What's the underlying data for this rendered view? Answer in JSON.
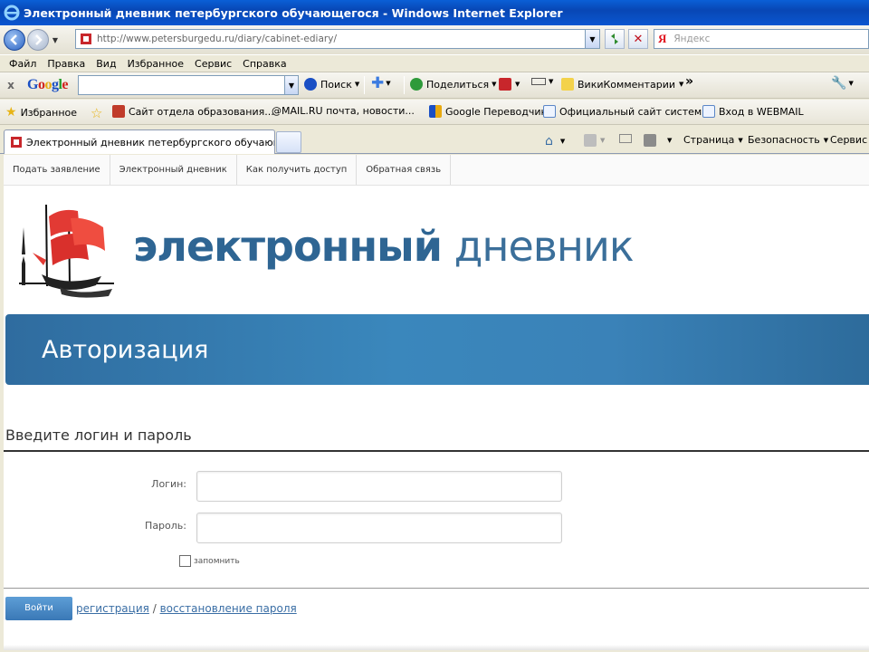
{
  "window": {
    "title": "Электронный дневник петербургского обучающегося - Windows Internet Explorer"
  },
  "address": {
    "url": "http://www.petersburgedu.ru/diary/cabinet-ediary/",
    "search_placeholder": "Яндекс",
    "search_brand": "Я"
  },
  "menu": [
    "Файл",
    "Правка",
    "Вид",
    "Избранное",
    "Сервис",
    "Справка"
  ],
  "google_bar": {
    "logo": "Google",
    "search_label": "Поиск",
    "share_label": "Поделиться",
    "wiki_label": "ВикиКомментарии",
    "more": "»"
  },
  "favorites": {
    "label": "Избранное",
    "items": [
      "Сайт отдела образования...",
      "@MAIL.RU почта, новости...",
      "Google Переводчик",
      "Официальный сайт систем...",
      "Вход в WEBMAIL"
    ]
  },
  "tab": {
    "title": "Электронный дневник петербургского обучающег..."
  },
  "commands": {
    "page": "Страница",
    "safety": "Безопасность",
    "tools": "Сервис"
  },
  "site": {
    "nav": [
      "Подать заявление",
      "Электронный дневник",
      "Как получить доступ",
      "Обратная связь"
    ],
    "brand_bold": "электронный",
    "brand_light": "дневник",
    "banner_title": "Авторизация",
    "form_heading": "Введите логин и пароль",
    "login_label": "Логин:",
    "password_label": "Пароль:",
    "remember_label": "запомнить",
    "submit_label": "Войти",
    "register_link": "регистрация",
    "divider": "/",
    "recover_link": "восстановление пароля"
  },
  "colors": {
    "brand_blue": "#2e6593",
    "banner_blue": "#3a87bc",
    "link_blue": "#3a6ea5",
    "xp_titlebar": "#0a56d0"
  }
}
